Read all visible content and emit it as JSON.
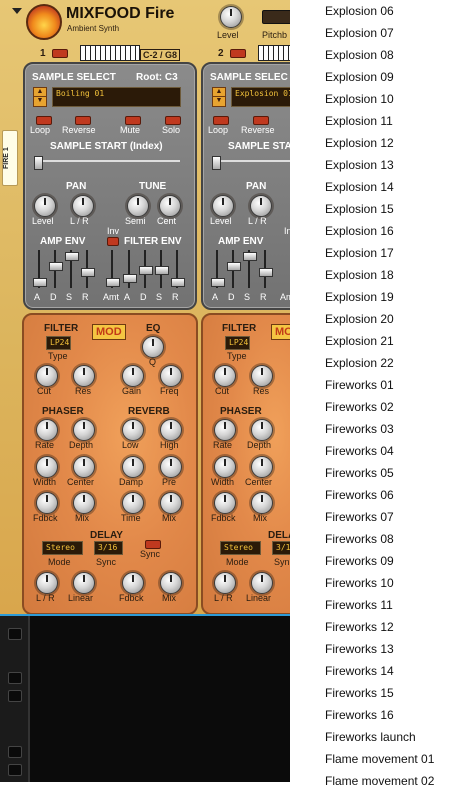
{
  "synth": {
    "brand": "MIXFOOD Fire",
    "subtitle": "Ambient Synth",
    "side_tab": "FIRE 1",
    "level_label": "Level",
    "pitchbend_label": "Pitchb",
    "channels": [
      {
        "number": "1",
        "range": "C-2 / G8",
        "sample_select": "SAMPLE SELECT",
        "root": "Root: C3",
        "sample": "Boiling 01",
        "toggles": [
          "Loop",
          "Reverse",
          "Mute",
          "Solo"
        ],
        "sample_start": "SAMPLE START (Index)",
        "pan": "PAN",
        "tune": "TUNE",
        "pan_knobs": [
          "Level",
          "L / R"
        ],
        "tune_knobs": [
          "Semi",
          "Cent"
        ],
        "amp_env": "AMP ENV",
        "filter_env": "FILTER ENV",
        "inv": "Inv",
        "amp_faders": [
          "A",
          "D",
          "S",
          "R"
        ],
        "filter_faders": [
          "Amt",
          "A",
          "D",
          "S",
          "R"
        ],
        "filter": "FILTER",
        "filter_type": "LP24",
        "type_label": "Type",
        "mod": "MOD",
        "eq": "EQ",
        "q": "Q",
        "filter_knobs": [
          "Cut",
          "Res",
          "Gain",
          "Freq"
        ],
        "phaser": "PHASER",
        "reverb": "REVERB",
        "phaser_knobs": [
          "Rate",
          "Depth",
          "Width",
          "Center",
          "Fdbck",
          "Mix"
        ],
        "reverb_knobs": [
          "Low",
          "High",
          "Damp",
          "Pre",
          "Time",
          "Mix"
        ],
        "delay": "DELAY",
        "delay_mode": "Stereo",
        "delay_sync_val": "3/16",
        "sync": "Sync",
        "mode_label": "Mode",
        "sync_label": "Sync",
        "delay_knobs": [
          "L / R",
          "Linear",
          "Fdbck",
          "Mix"
        ]
      },
      {
        "number": "2",
        "sample_select": "SAMPLE SELEC",
        "sample": "Explosion 01",
        "toggles": [
          "Loop",
          "Reverse"
        ],
        "sample_start": "SAMPLE STA",
        "pan": "PAN",
        "pan_knobs": [
          "Level",
          "L / R"
        ],
        "amp_env": "AMP ENV",
        "inv": "In",
        "amp_faders": [
          "A",
          "D",
          "S",
          "R"
        ],
        "amt": "Am",
        "filter": "FILTER",
        "filter_type": "LP24",
        "type_label": "Type",
        "mod": "MO",
        "filter_knobs": [
          "Cut",
          "Res"
        ],
        "phaser": "PHASER",
        "phaser_knobs": [
          "Rate",
          "Depth",
          "Width",
          "Center",
          "Fdbck",
          "Mix"
        ],
        "delay": "DELA",
        "delay_mode": "Stereo",
        "delay_sync_val": "3/1",
        "mode_label": "Mode",
        "sync_label": "Syn",
        "delay_knobs": [
          "L / R",
          "Linear"
        ]
      }
    ]
  },
  "list": {
    "items": [
      "Explosion 06",
      "Explosion 07",
      "Explosion 08",
      "Explosion 09",
      "Explosion 10",
      "Explosion 11",
      "Explosion 12",
      "Explosion 13",
      "Explosion 14",
      "Explosion 15",
      "Explosion 16",
      "Explosion 17",
      "Explosion 18",
      "Explosion 19",
      "Explosion 20",
      "Explosion 21",
      "Explosion 22",
      "Fireworks 01",
      "Fireworks 02",
      "Fireworks 03",
      "Fireworks 04",
      "Fireworks 05",
      "Fireworks 06",
      "Fireworks 07",
      "Fireworks 08",
      "Fireworks 09",
      "Fireworks 10",
      "Fireworks 11",
      "Fireworks 12",
      "Fireworks 13",
      "Fireworks 14",
      "Fireworks 15",
      "Fireworks 16",
      "Fireworks launch",
      "Flame movement 01",
      "Flame movement 02"
    ]
  },
  "colors": {
    "accent": "#2e9bd6",
    "display_text": "#f3c23b",
    "led": "#c0391f"
  }
}
